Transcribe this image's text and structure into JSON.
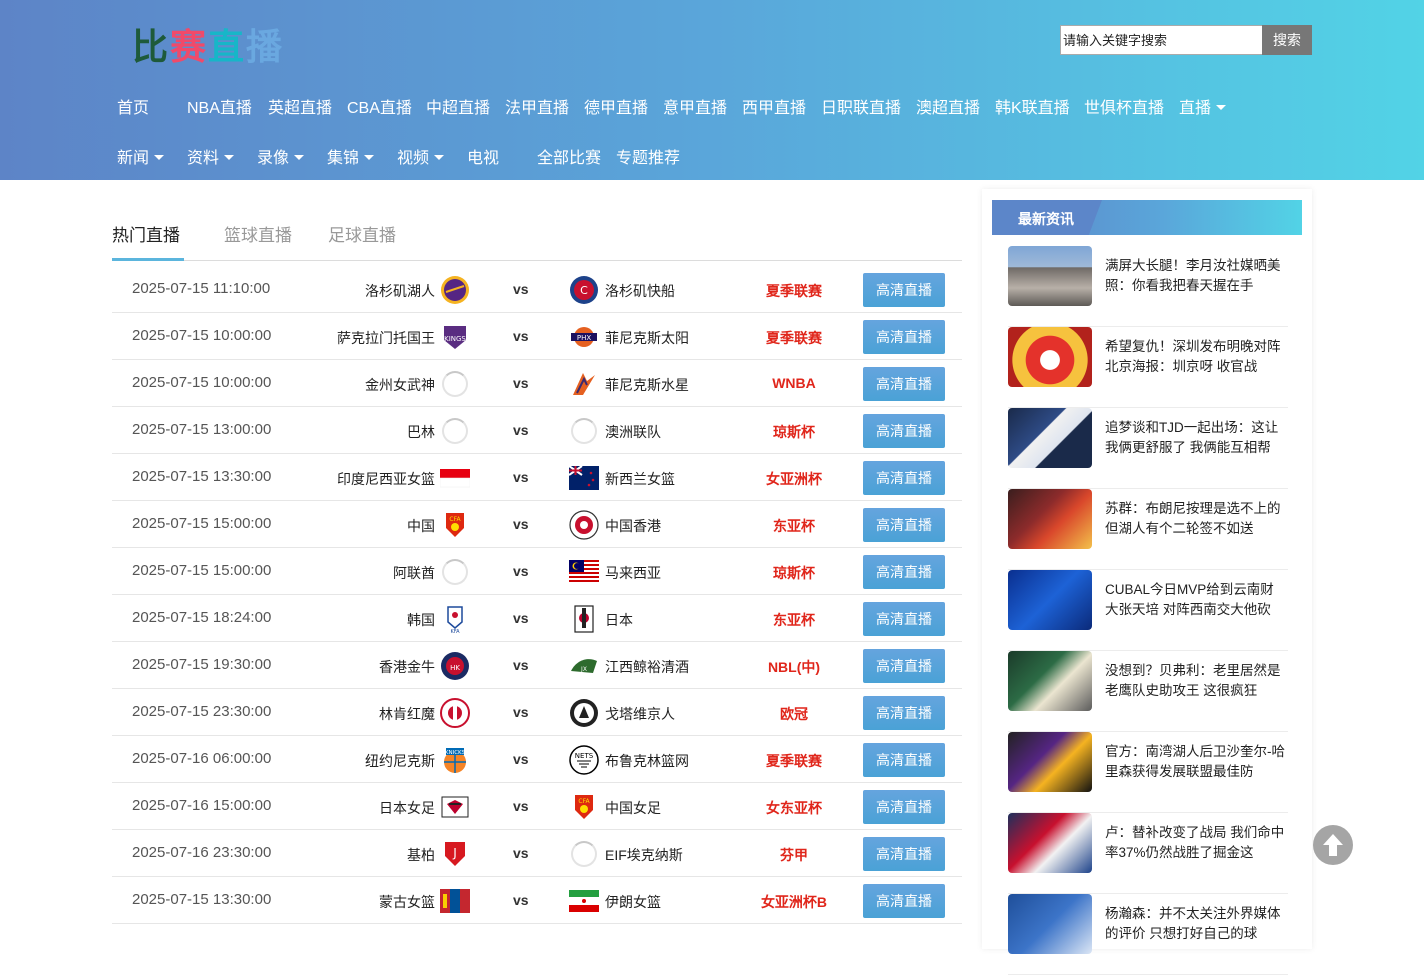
{
  "header": {
    "logo_chars": [
      {
        "char": "比",
        "color": "#1e5a3a"
      },
      {
        "char": "赛",
        "color": "#f04a6a"
      },
      {
        "char": "直",
        "color": "#17b6c8"
      },
      {
        "char": "播",
        "color": "#6aa8e0"
      }
    ],
    "search_placeholder": "请输入关键字搜索",
    "search_button": "搜索"
  },
  "nav": {
    "row1": [
      {
        "label": "首页"
      },
      {
        "label": "NBA直播"
      },
      {
        "label": "英超直播"
      },
      {
        "label": "CBA直播"
      },
      {
        "label": "中超直播"
      },
      {
        "label": "法甲直播"
      },
      {
        "label": "德甲直播"
      },
      {
        "label": "意甲直播"
      },
      {
        "label": "西甲直播"
      },
      {
        "label": "日职联直播"
      },
      {
        "label": "澳超直播"
      },
      {
        "label": "韩K联直播"
      },
      {
        "label": "世俱杯直播"
      },
      {
        "label": "直播"
      }
    ],
    "row2": [
      {
        "label": "新闻"
      },
      {
        "label": "资料"
      },
      {
        "label": "录像"
      },
      {
        "label": "集锦"
      },
      {
        "label": "视频"
      },
      {
        "label": "电视"
      },
      {
        "label": "全部比赛"
      },
      {
        "label": "专题推荐"
      }
    ]
  },
  "tabs": [
    {
      "label": "热门直播",
      "active": true
    },
    {
      "label": "篮球直播",
      "active": false
    },
    {
      "label": "足球直播",
      "active": false
    }
  ],
  "vs_label": "vs",
  "watch_label": "高清直播",
  "matches": [
    {
      "time": "2025-07-15 11:10:00",
      "home": "洛杉矶湖人",
      "home_logo": "lakers-logo",
      "away": "洛杉矶快船",
      "away_logo": "clippers-logo",
      "league": "夏季联赛"
    },
    {
      "time": "2025-07-15 10:00:00",
      "home": "萨克拉门托国王",
      "home_logo": "kings-logo",
      "away": "菲尼克斯太阳",
      "away_logo": "suns-logo",
      "league": "夏季联赛"
    },
    {
      "time": "2025-07-15 10:00:00",
      "home": "金州女武神",
      "home_logo": "loading-icon",
      "away": "菲尼克斯水星",
      "away_logo": "mercury-logo",
      "league": "WNBA"
    },
    {
      "time": "2025-07-15 13:00:00",
      "home": "巴林",
      "home_logo": "loading-icon",
      "away": "澳洲联队",
      "away_logo": "loading-icon",
      "league": "琼斯杯"
    },
    {
      "time": "2025-07-15 13:30:00",
      "home": "印度尼西亚女篮",
      "home_logo": "indonesia-flag",
      "away": "新西兰女篮",
      "away_logo": "new-zealand-flag",
      "league": "女亚洲杯"
    },
    {
      "time": "2025-07-15 15:00:00",
      "home": "中国",
      "home_logo": "cfa-logo",
      "away": "中国香港",
      "away_logo": "hkfa-logo",
      "league": "东亚杯"
    },
    {
      "time": "2025-07-15 15:00:00",
      "home": "阿联酋",
      "home_logo": "loading-icon",
      "away": "马来西亚",
      "away_logo": "malaysia-flag",
      "league": "琼斯杯"
    },
    {
      "time": "2025-07-15 18:24:00",
      "home": "韩国",
      "home_logo": "kfa-logo",
      "away": "日本",
      "away_logo": "jfa-logo",
      "league": "东亚杯"
    },
    {
      "time": "2025-07-15 19:30:00",
      "home": "香港金牛",
      "home_logo": "bulls-logo",
      "away": "江西鲸裕清酒",
      "away_logo": "jiangxi-logo",
      "league": "NBL(中)"
    },
    {
      "time": "2025-07-15 23:30:00",
      "home": "林肯红魔",
      "home_logo": "lincoln-logo",
      "away": "戈塔维京人",
      "away_logo": "vikings-logo",
      "league": "欧冠"
    },
    {
      "time": "2025-07-16 06:00:00",
      "home": "纽约尼克斯",
      "home_logo": "knicks-logo",
      "away": "布鲁克林篮网",
      "away_logo": "nets-logo",
      "league": "夏季联赛"
    },
    {
      "time": "2025-07-16 15:00:00",
      "home": "日本女足",
      "home_logo": "jfa-women-logo",
      "away": "中国女足",
      "away_logo": "cfa-logo",
      "league": "女东亚杯"
    },
    {
      "time": "2025-07-16 23:30:00",
      "home": "基柏",
      "home_logo": "jagiellonia-logo",
      "away": "EIF埃克纳斯",
      "away_logo": "loading-icon",
      "league": "芬甲"
    },
    {
      "time": "2025-07-15 13:30:00",
      "home": "蒙古女篮",
      "home_logo": "mongolia-flag",
      "away": "伊朗女篮",
      "away_logo": "iran-flag",
      "league": "女亚洲杯B"
    }
  ],
  "sidebar": {
    "title": "最新资讯",
    "news": [
      {
        "text": "满屏大长腿！李月汝社媒晒美照：你看我把春天握在手",
        "thumb": "photo-street"
      },
      {
        "text": "希望复仇！深圳发布明晚对阵北京海报：圳京呀 收官战",
        "thumb": "poster-cartoon"
      },
      {
        "text": "追梦谈和TJD一起出场：这让我俩更舒服了 我俩能互相帮",
        "thumb": "photo-warriors"
      },
      {
        "text": "苏群：布朗尼按理是选不上的 但湖人有个二轮签不如送",
        "thumb": "photo-lakers"
      },
      {
        "text": "CUBAL今日MVP给到云南财大张天培 对阵西南交大他砍",
        "thumb": "poster-cubal"
      },
      {
        "text": "没想到？贝弗利：老里居然是老鹰队史助攻王 这很疯狂",
        "thumb": "photo-bucks"
      },
      {
        "text": "官方：南湾湖人后卫沙奎尔-哈里森获得发展联盟最佳防",
        "thumb": "poster-harrison"
      },
      {
        "text": "卢：替补改变了战局 我们命中率37%仍然战胜了掘金这",
        "thumb": "photo-clippers"
      },
      {
        "text": "杨瀚森：并不太关注外界媒体的评价 只想打好自己的球",
        "thumb": "photo-qingdao"
      }
    ]
  }
}
